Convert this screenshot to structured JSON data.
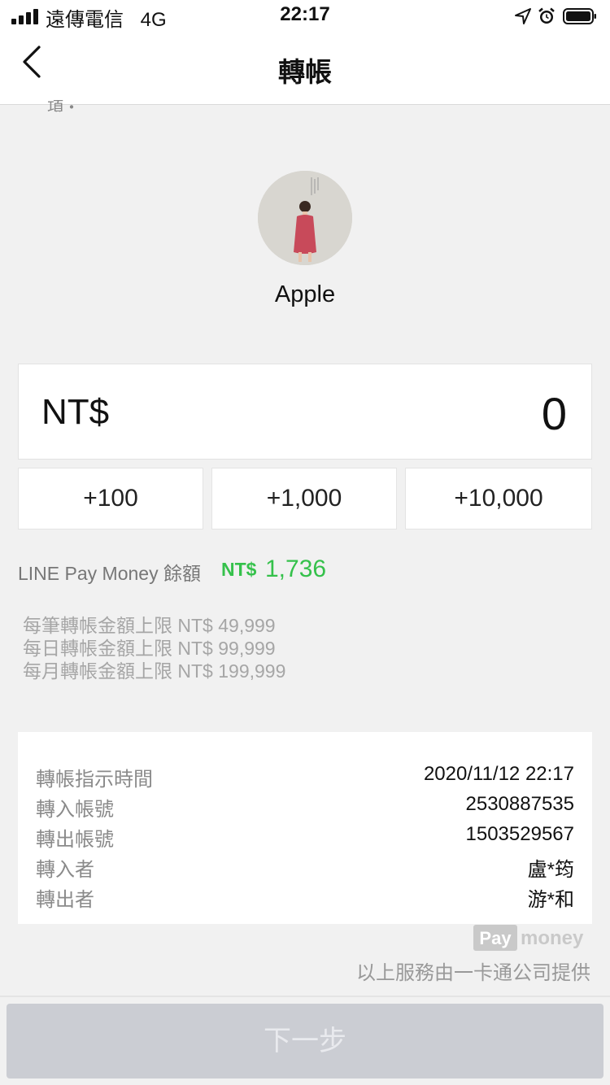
{
  "status_bar": {
    "carrier": "遠傳電信",
    "network": "4G",
    "time": "22:17"
  },
  "nav": {
    "title": "轉帳",
    "faded_text": "項・"
  },
  "recipient": {
    "name": "Apple"
  },
  "amount": {
    "currency": "NT$",
    "value": "0"
  },
  "quick_add": [
    "+100",
    "+1,000",
    "+10,000"
  ],
  "balance": {
    "label": "LINE Pay Money 餘額",
    "currency": "NT$",
    "value": "1,736",
    "color": "#35c14b"
  },
  "limits": [
    "每筆轉帳金額上限 NT$ 49,999",
    "每日轉帳金額上限 NT$ 99,999",
    "每月轉帳金額上限 NT$ 199,999"
  ],
  "details": [
    {
      "label": "轉帳指示時間",
      "value": "2020/11/12 22:17"
    },
    {
      "label": "轉入帳號",
      "value": "2530887535"
    },
    {
      "label": "轉出帳號",
      "value": "1503529567"
    },
    {
      "label": "轉入者",
      "value": "盧*筠"
    },
    {
      "label": "轉出者",
      "value": "游*和"
    }
  ],
  "logo": {
    "part1": "Pay",
    "part2": "money"
  },
  "provider_note": "以上服務由一卡通公司提供",
  "next_button": "下一步"
}
